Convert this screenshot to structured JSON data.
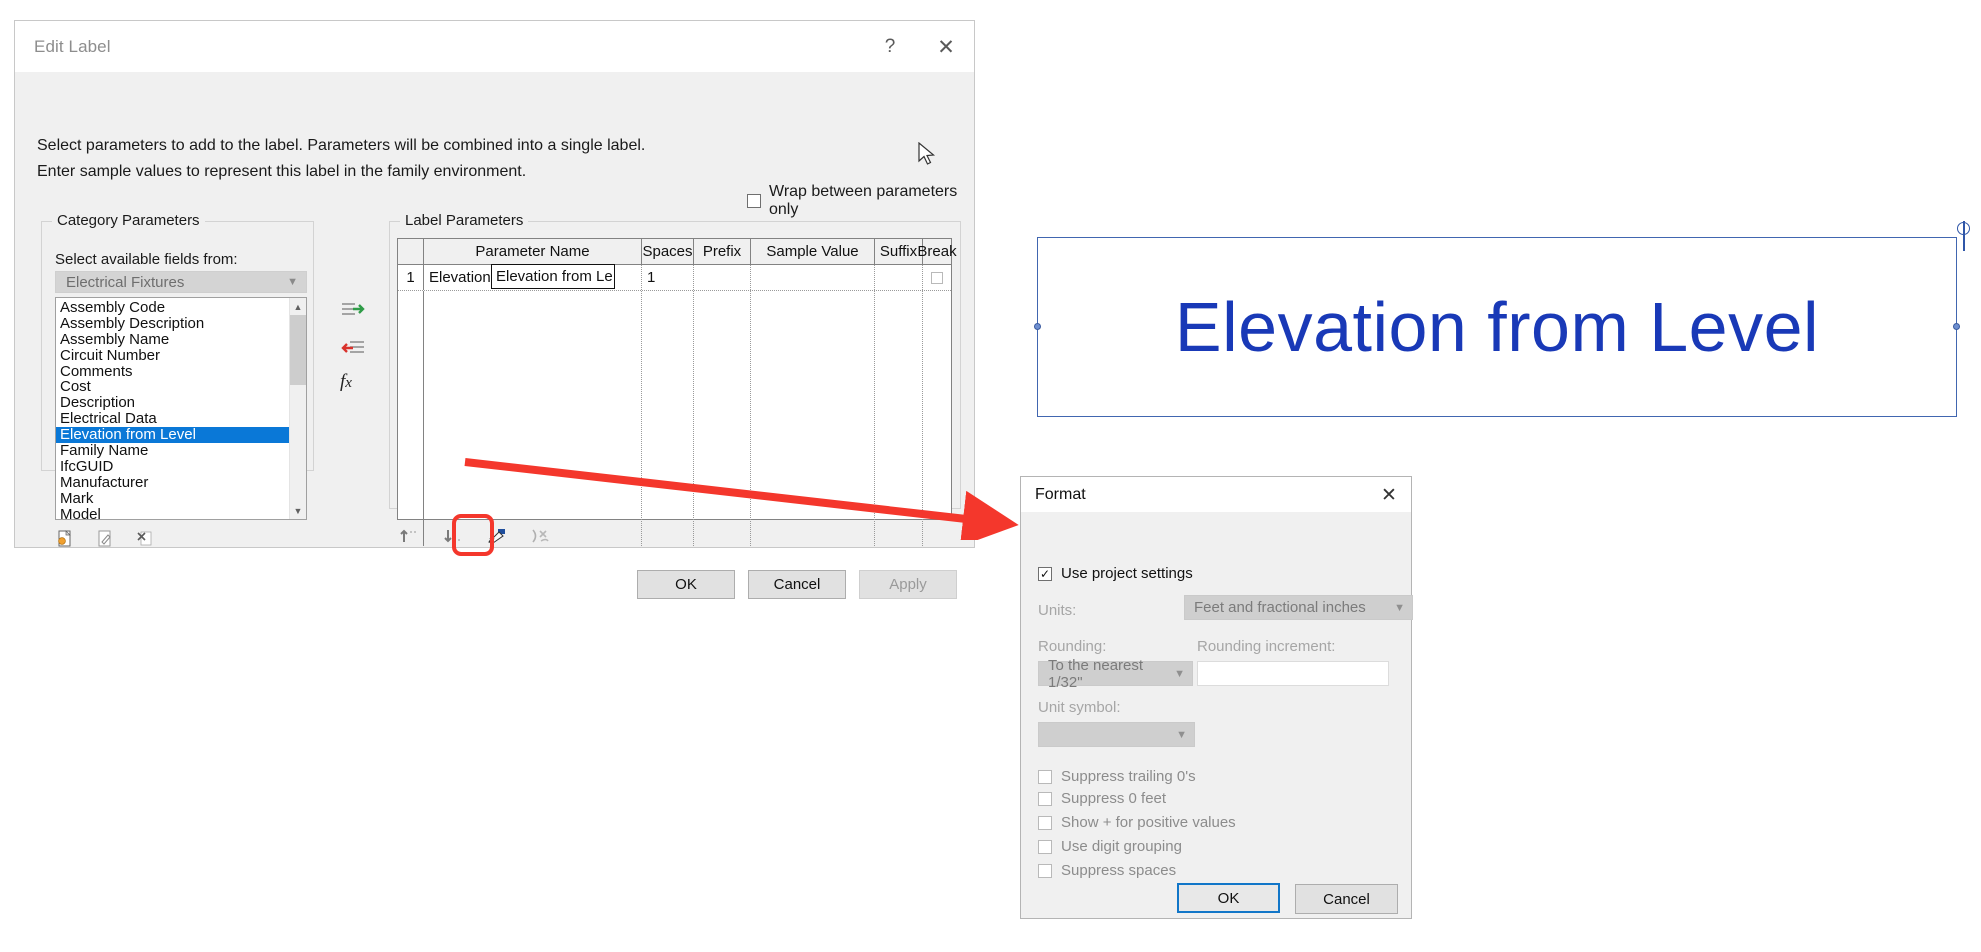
{
  "edit_label_dialog": {
    "title": "Edit Label",
    "help_icon": "?",
    "close_icon": "✕",
    "instruction_line_1": "Select parameters to add to the label.  Parameters will be combined into a single label.",
    "instruction_line_2": "Enter sample values to represent this label in the family environment.",
    "wrap_checkbox_label": "Wrap between parameters only",
    "wrap_checkbox_checked": false,
    "category_parameters": {
      "legend": "Category Parameters",
      "select_fields_label": "Select available fields from:",
      "category_combo_value": "Electrical Fixtures",
      "available_fields": [
        "Assembly Code",
        "Assembly Description",
        "Assembly Name",
        "Circuit Number",
        "Comments",
        "Cost",
        "Description",
        "Electrical Data",
        "Elevation from Level",
        "Family Name",
        "IfcGUID",
        "Manufacturer",
        "Mark",
        "Model"
      ],
      "selected_field": "Elevation from Level",
      "bottom_icons": [
        "new-parameter-icon",
        "edit-parameter-icon",
        "delete-parameter-icon"
      ]
    },
    "transfer_buttons": [
      "add-parameter-to-label-icon",
      "remove-parameter-from-label-icon",
      "fx-formula-icon"
    ],
    "label_parameters": {
      "legend": "Label Parameters",
      "columns": [
        "",
        "Parameter Name",
        "Spaces",
        "Prefix",
        "Sample Value",
        "Suffix",
        "Break"
      ],
      "rows": [
        {
          "index": "1",
          "parameter_name": "Elevation from Level",
          "spaces": "1",
          "prefix": "",
          "sample_value": "Elevation from Le",
          "suffix": "",
          "break": false
        }
      ],
      "toolbar_icons": [
        "move-up-icon",
        "move-down-icon",
        "edit-parameters-unit-format-icon",
        "group-parameters-icon"
      ],
      "highlighted_toolbar_icon": "edit-parameters-unit-format-icon"
    },
    "buttons": {
      "ok": "OK",
      "cancel": "Cancel",
      "apply": "Apply",
      "apply_disabled": true
    }
  },
  "canvas": {
    "label_text": "Elevation from Level",
    "label_color": "#1939b7",
    "selection_border_color": "#4166b0"
  },
  "format_dialog": {
    "title": "Format",
    "close_icon": "✕",
    "use_project_settings": {
      "label": "Use project settings",
      "checked": true
    },
    "units": {
      "label": "Units:",
      "value": "Feet and fractional inches",
      "enabled": false
    },
    "rounding": {
      "label": "Rounding:",
      "value": "To the nearest 1/32\"",
      "enabled": false
    },
    "rounding_increment": {
      "label": "Rounding increment:",
      "value": "",
      "enabled": false
    },
    "unit_symbol": {
      "label": "Unit symbol:",
      "value": "",
      "enabled": false
    },
    "options": [
      {
        "label": "Suppress trailing 0's",
        "checked": false
      },
      {
        "label": "Suppress 0 feet",
        "checked": false
      },
      {
        "label": "Show + for positive values",
        "checked": false
      },
      {
        "label": "Use digit grouping",
        "checked": false
      },
      {
        "label": "Suppress spaces",
        "checked": false
      }
    ],
    "buttons": {
      "ok": "OK",
      "cancel": "Cancel"
    }
  },
  "annotation": {
    "arrow_color": "#f4372c",
    "highlight_box_color": "#f4372c"
  }
}
